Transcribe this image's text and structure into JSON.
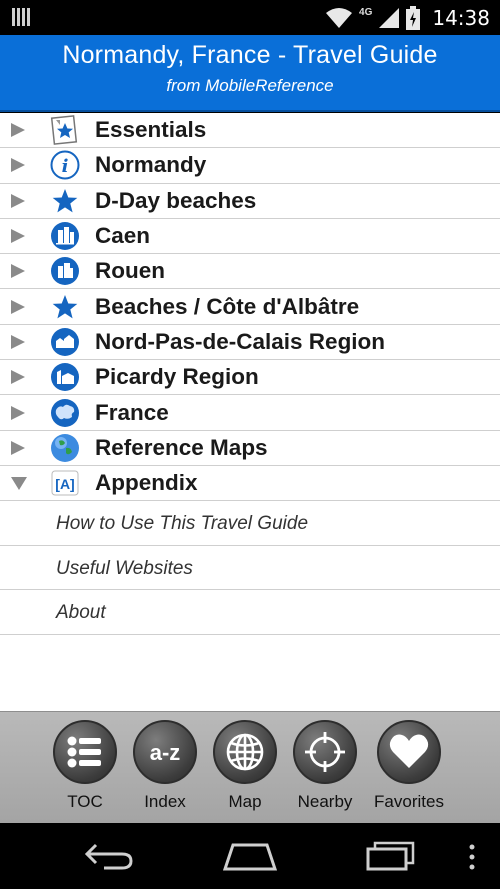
{
  "status_bar": {
    "network": "4G",
    "time": "14:38"
  },
  "header": {
    "title": "Normandy, France - Travel Guide",
    "subtitle": "from MobileReference"
  },
  "list": {
    "items": [
      {
        "label": "Essentials",
        "icon": "essentials-icon",
        "expanded": false
      },
      {
        "label": "Normandy",
        "icon": "info-icon",
        "expanded": false
      },
      {
        "label": "D-Day beaches",
        "icon": "star-icon",
        "expanded": false
      },
      {
        "label": "Caen",
        "icon": "city-icon",
        "expanded": false
      },
      {
        "label": "Rouen",
        "icon": "city-icon",
        "expanded": false
      },
      {
        "label": "Beaches / Côte d'Albâtre",
        "icon": "star-icon",
        "expanded": false
      },
      {
        "label": "Nord-Pas-de-Calais Region",
        "icon": "town-icon",
        "expanded": false
      },
      {
        "label": "Picardy Region",
        "icon": "town-icon",
        "expanded": false
      },
      {
        "label": "France",
        "icon": "europe-map-icon",
        "expanded": false
      },
      {
        "label": "Reference Maps",
        "icon": "globe-icon",
        "expanded": false
      },
      {
        "label": "Appendix",
        "icon": "appendix-icon",
        "expanded": true
      }
    ],
    "subitems": [
      {
        "label": "How to Use This Travel Guide"
      },
      {
        "label": "Useful Websites"
      },
      {
        "label": "About"
      }
    ]
  },
  "toolbar": {
    "buttons": [
      {
        "label": "TOC",
        "icon": "list-icon"
      },
      {
        "label": "Index",
        "icon": "a-z-icon",
        "icon_text": "a-z"
      },
      {
        "label": "Map",
        "icon": "globe-grid-icon"
      },
      {
        "label": "Nearby",
        "icon": "crosshair-icon"
      },
      {
        "label": "Favorites",
        "icon": "heart-icon"
      }
    ]
  },
  "colors": {
    "header_bg": "#0a6fd8",
    "accent_blue": "#1565c0"
  }
}
